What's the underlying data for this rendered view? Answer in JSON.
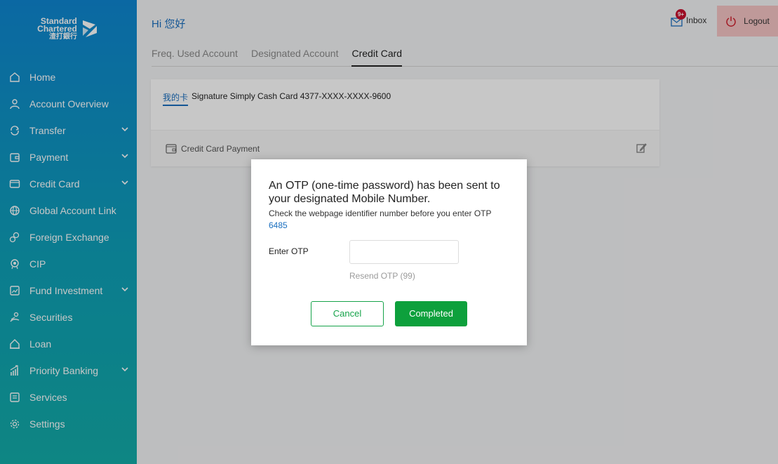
{
  "brand": {
    "line1": "Standard",
    "line2": "Chartered",
    "line3": "渣打銀行"
  },
  "sidebar": {
    "items": [
      {
        "label": "Home",
        "icon": "home-icon"
      },
      {
        "label": "Account Overview",
        "icon": "user-icon"
      },
      {
        "label": "Transfer",
        "icon": "transfer-icon"
      },
      {
        "label": "Payment",
        "icon": "wallet-icon"
      },
      {
        "label": "Credit Card",
        "icon": "card-icon"
      },
      {
        "label": "Global Account Link",
        "icon": "globe-icon"
      },
      {
        "label": "Foreign Exchange",
        "icon": "exchange-icon"
      },
      {
        "label": "CIP",
        "icon": "badge-icon"
      },
      {
        "label": "Fund Investment",
        "icon": "chart-icon"
      },
      {
        "label": "Securities",
        "icon": "securities-icon"
      },
      {
        "label": "Loan",
        "icon": "loan-icon"
      },
      {
        "label": "Priority Banking",
        "icon": "priority-icon"
      },
      {
        "label": "Services",
        "icon": "services-icon"
      },
      {
        "label": "Settings",
        "icon": "gear-icon"
      }
    ]
  },
  "header": {
    "greeting": "Hi 您好",
    "inbox_label": "Inbox",
    "inbox_badge": "9+",
    "logout_label": "Logout"
  },
  "tabs": [
    {
      "label": "Freq. Used Account"
    },
    {
      "label": "Designated Account"
    },
    {
      "label": "Credit Card"
    }
  ],
  "card": {
    "my_card_label": "我的卡",
    "card_name": "Signature Simply Cash Card  4377-XXXX-XXXX-9600",
    "payment_label": "Credit Card Payment"
  },
  "modal": {
    "title": "An OTP (one-time password) has been sent to your designated Mobile Number.",
    "subtitle": "Check the webpage identifier number before you enter OTP",
    "identifier": "6485",
    "otp_label": "Enter OTP",
    "otp_value": "",
    "resend_label": "Resend OTP (99)",
    "cancel_label": "Cancel",
    "completed_label": "Completed"
  },
  "colors": {
    "accent_blue": "#1a6fbf",
    "green": "#0da03c",
    "logout_bg": "#f5c5c5",
    "badge_red": "#c8102e"
  }
}
